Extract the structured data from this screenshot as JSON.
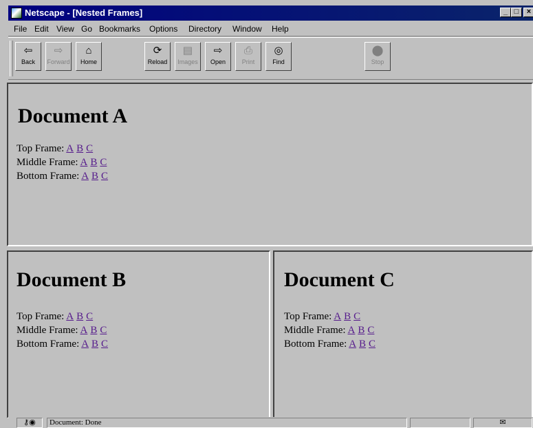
{
  "window": {
    "title": "Netscape - [Nested Frames]",
    "controls": {
      "minimize": "_",
      "maximize": "□",
      "close": "×"
    }
  },
  "menu": [
    {
      "label": "File"
    },
    {
      "label": "Edit"
    },
    {
      "label": "View"
    },
    {
      "label": "Go"
    },
    {
      "label": "Bookmarks"
    },
    {
      "label": "Options"
    },
    {
      "label": "Directory"
    },
    {
      "label": "Window"
    },
    {
      "label": "Help"
    }
  ],
  "toolbar": {
    "back": {
      "label": "Back",
      "icon": "back-arrow",
      "enabled": true
    },
    "forward": {
      "label": "Forward",
      "icon": "forward-arrow",
      "enabled": false
    },
    "home": {
      "label": "Home",
      "icon": "house",
      "enabled": true
    },
    "reload": {
      "label": "Reload",
      "icon": "reload-arrows",
      "enabled": true
    },
    "images": {
      "label": "Images",
      "icon": "images",
      "enabled": false
    },
    "open": {
      "label": "Open",
      "icon": "open-location",
      "enabled": true
    },
    "print": {
      "label": "Print",
      "icon": "printer",
      "enabled": false
    },
    "find": {
      "label": "Find",
      "icon": "binoculars",
      "enabled": true
    },
    "stop": {
      "label": "Stop",
      "icon": "stop-sign",
      "enabled": false
    }
  },
  "frames": {
    "a": {
      "heading": "Document A"
    },
    "b": {
      "heading": "Document B"
    },
    "c": {
      "heading": "Document C"
    }
  },
  "frame_links": {
    "top_label": "Top Frame:",
    "middle_label": "Middle Frame:",
    "bottom_label": "Bottom Frame:",
    "links": [
      "A",
      "B",
      "C"
    ]
  },
  "status": {
    "text": "Document: Done",
    "security_icon": "key-lock-icon",
    "mail_icon": "envelope-icon"
  },
  "colors": {
    "titlebar": "#000080",
    "chrome": "#c0c0c0",
    "link_visited": "#551a8b"
  }
}
